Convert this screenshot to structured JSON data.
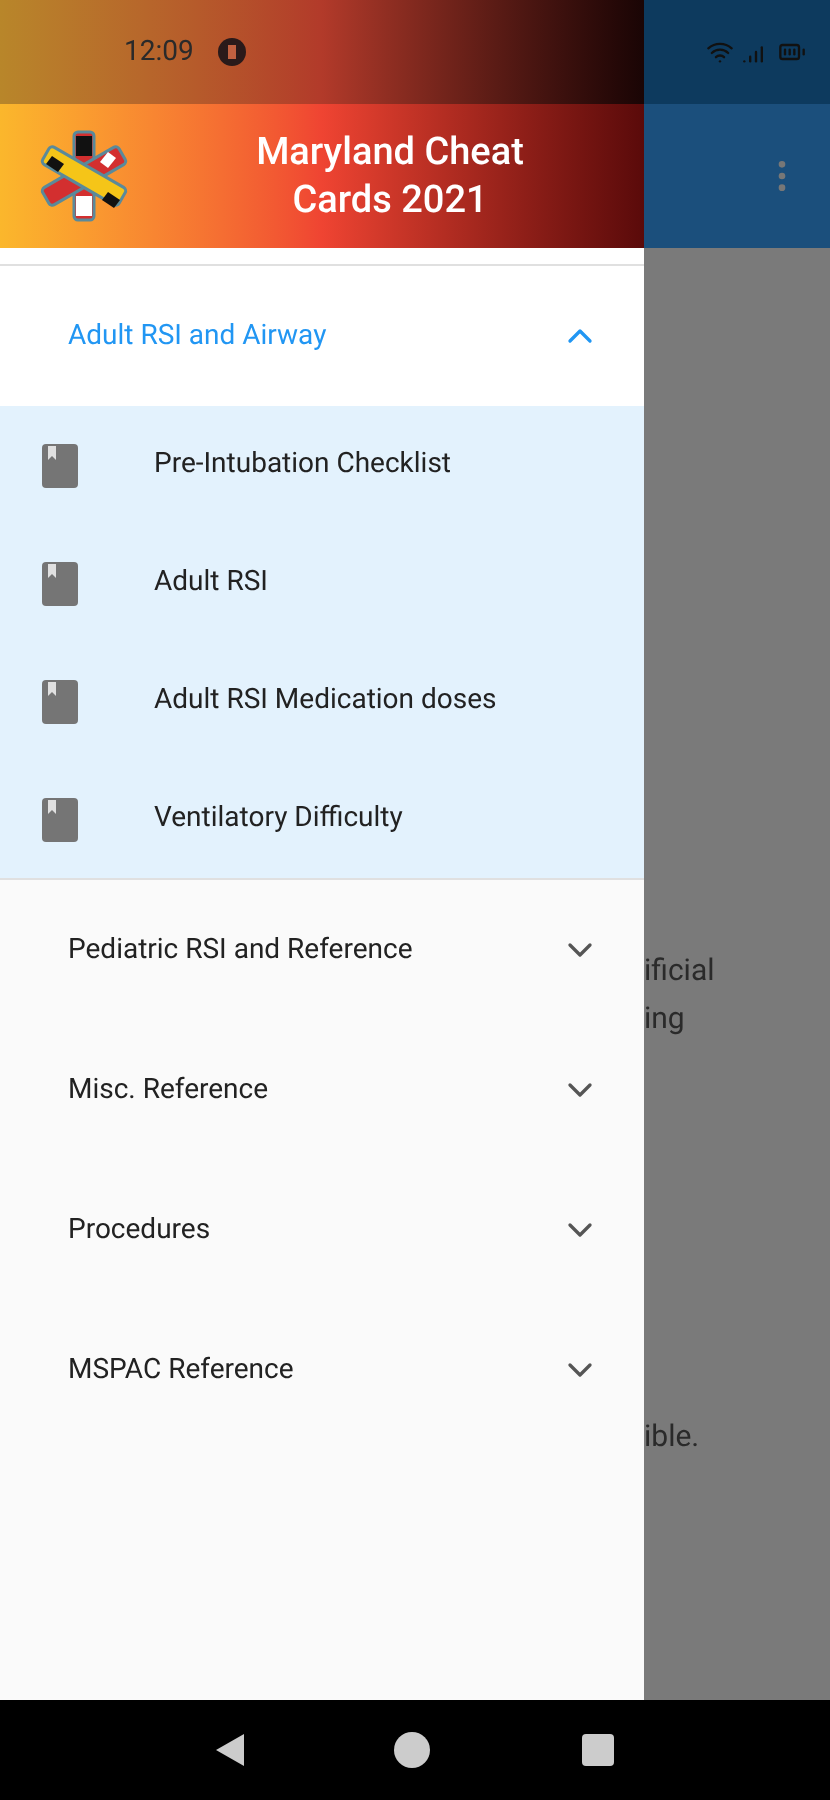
{
  "status_bar": {
    "time": "12:09"
  },
  "drawer": {
    "title": "Maryland Cheat Cards 2021",
    "sections": [
      {
        "label": "Adult RSI and Airway",
        "expanded": true,
        "items": [
          "Pre-Intubation Checklist",
          "Adult RSI",
          "Adult RSI Medication doses",
          "Ventilatory Difficulty"
        ]
      },
      {
        "label": "Pediatric RSI and Reference",
        "expanded": false
      },
      {
        "label": "Misc. Reference",
        "expanded": false
      },
      {
        "label": "Procedures",
        "expanded": false
      },
      {
        "label": "MSPAC Reference",
        "expanded": false
      }
    ]
  },
  "background_texts": [
    "ificial",
    "ing",
    "ible."
  ]
}
